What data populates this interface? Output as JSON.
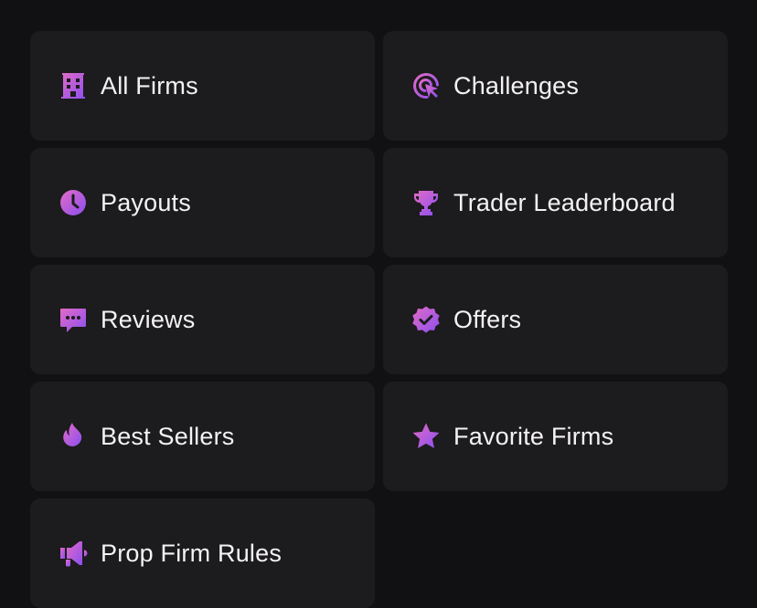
{
  "accent": {
    "from": "#e06bc9",
    "to": "#8a4cf0"
  },
  "menu": {
    "items": [
      {
        "label": "All Firms",
        "icon": "building-icon"
      },
      {
        "label": "Challenges",
        "icon": "target-cursor-icon"
      },
      {
        "label": "Payouts",
        "icon": "clock-icon"
      },
      {
        "label": "Trader Leaderboard",
        "icon": "trophy-icon"
      },
      {
        "label": "Reviews",
        "icon": "chat-bubble-icon"
      },
      {
        "label": "Offers",
        "icon": "verified-badge-icon"
      },
      {
        "label": "Best Sellers",
        "icon": "flame-icon"
      },
      {
        "label": "Favorite Firms",
        "icon": "star-icon"
      },
      {
        "label": "Prop Firm Rules",
        "icon": "megaphone-icon"
      }
    ]
  }
}
